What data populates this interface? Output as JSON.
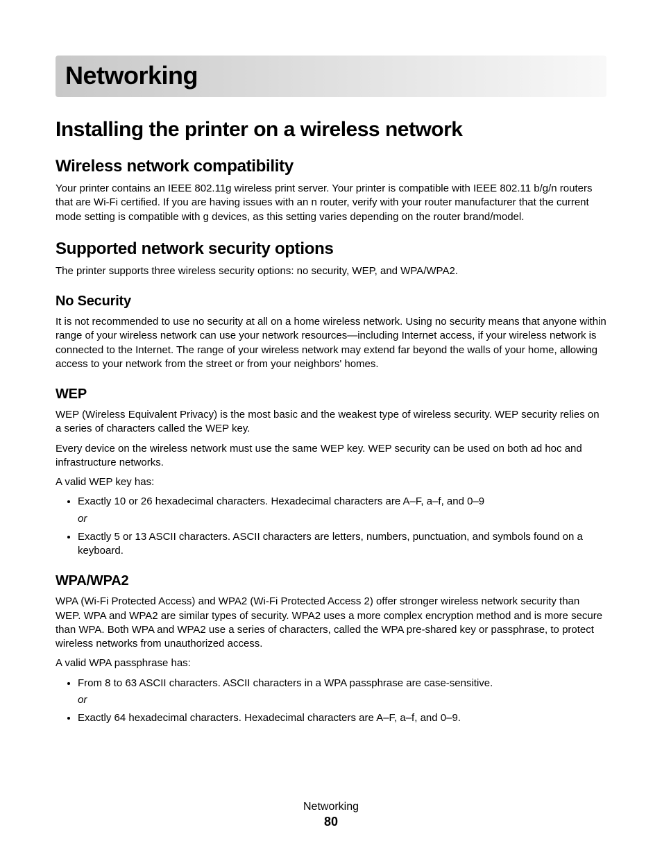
{
  "chapter_title": "Networking",
  "section_title": "Installing the printer on a wireless network",
  "compat": {
    "heading": "Wireless network compatibility",
    "body": "Your printer contains an IEEE 802.11g wireless print server. Your printer is compatible with IEEE 802.11 b/g/n routers that are Wi-Fi certified. If you are having issues with an n router, verify with your router manufacturer that the current mode setting is compatible with g devices, as this setting varies depending on the router brand/model."
  },
  "security": {
    "heading": "Supported network security options",
    "intro": "The printer supports three wireless security options: no security, WEP, and WPA/WPA2.",
    "none": {
      "heading": "No Security",
      "body": "It is not recommended to use no security at all on a home wireless network. Using no security means that anyone within range of your wireless network can use your network resources—including Internet access, if your wireless network is connected to the Internet. The range of your wireless network may extend far beyond the walls of your home, allowing access to your network from the street or from your neighbors' homes."
    },
    "wep": {
      "heading": "WEP",
      "p1": "WEP (Wireless Equivalent Privacy) is the most basic and the weakest type of wireless security. WEP security relies on a series of characters called the WEP key.",
      "p2": "Every device on the wireless network must use the same WEP key. WEP security can be used on both ad hoc and infrastructure networks.",
      "p3": "A valid WEP key has:",
      "b1": "Exactly 10 or 26 hexadecimal characters. Hexadecimal characters are A–F, a–f, and 0–9",
      "or": "or",
      "b2": "Exactly 5 or 13 ASCII characters. ASCII characters are letters, numbers, punctuation, and symbols found on a keyboard."
    },
    "wpa": {
      "heading": "WPA/WPA2",
      "p1": "WPA (Wi-Fi Protected Access) and WPA2 (Wi-Fi Protected Access 2) offer stronger wireless network security than WEP. WPA and WPA2 are similar types of security. WPA2 uses a more complex encryption method and is more secure than WPA. Both WPA and WPA2 use a series of characters, called the WPA pre-shared key or passphrase, to protect wireless networks from unauthorized access.",
      "p2": "A valid WPA passphrase has:",
      "b1": "From 8 to 63 ASCII characters. ASCII characters in a WPA passphrase are case-sensitive.",
      "or": "or",
      "b2": "Exactly 64 hexadecimal characters. Hexadecimal characters are A–F, a–f, and 0–9."
    }
  },
  "footer": {
    "title": "Networking",
    "page": "80"
  }
}
